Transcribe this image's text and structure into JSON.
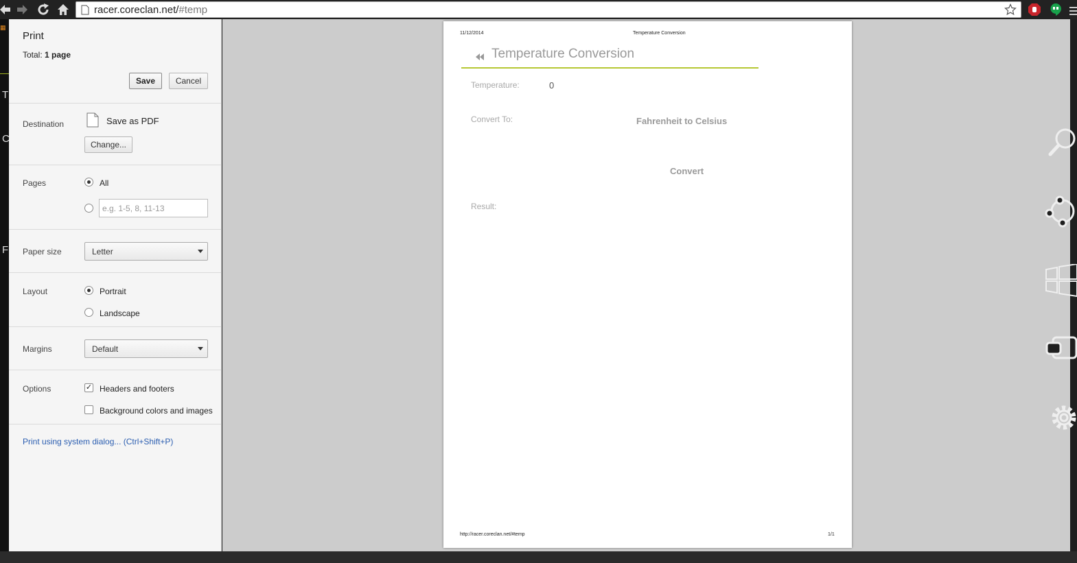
{
  "browser": {
    "url_host": "racer.coreclan.net/",
    "url_path": "#temp"
  },
  "left_strip": {
    "letters": [
      "T",
      "C",
      "F"
    ]
  },
  "print_panel": {
    "title": "Print",
    "total_label": "Total:",
    "total_value": "1 page",
    "save_label": "Save",
    "cancel_label": "Cancel",
    "destination": {
      "label": "Destination",
      "value": "Save as PDF",
      "change_label": "Change..."
    },
    "pages": {
      "label": "Pages",
      "all_label": "All",
      "range_placeholder": "e.g. 1-5, 8, 11-13"
    },
    "paper_size": {
      "label": "Paper size",
      "value": "Letter"
    },
    "layout": {
      "label": "Layout",
      "portrait": "Portrait",
      "landscape": "Landscape"
    },
    "margins": {
      "label": "Margins",
      "value": "Default"
    },
    "options": {
      "label": "Options",
      "headers_footers": "Headers and footers",
      "background": "Background colors and images"
    },
    "system_dialog_link": "Print using system dialog... (Ctrl+Shift+P)"
  },
  "preview": {
    "header_date": "11/12/2014",
    "header_title": "Temperature Conversion",
    "title": "Temperature Conversion",
    "temperature_label": "Temperature:",
    "temperature_value": "0",
    "convert_to_label": "Convert To:",
    "convert_to_value": "Fahrenheit to Celsius",
    "convert_button": "Convert",
    "result_label": "Result:",
    "footer_url": "http://racer.coreclan.net/#temp",
    "footer_page": "1/1"
  },
  "colors": {
    "accent_line": "#b5c733",
    "link": "#2a5db0"
  },
  "icons": [
    "back-icon",
    "forward-icon",
    "reload-icon",
    "home-icon",
    "page-icon",
    "star-icon",
    "adblock-icon",
    "hangouts-icon",
    "search-charm-icon",
    "share-charm-icon",
    "start-charm-icon",
    "devices-charm-icon",
    "settings-charm-icon",
    "rewind-icon",
    "document-icon"
  ]
}
